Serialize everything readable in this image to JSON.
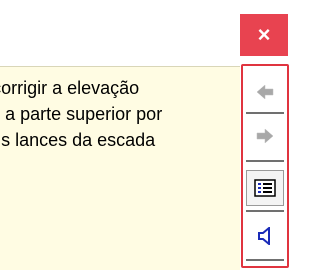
{
  "close_button": {
    "glyph": "×",
    "icon": "close-icon"
  },
  "content": {
    "lines": [
      "Se você quiser corrigir a elevação",
      "ao andar, agarre a parte superior por",
      "trás e pule alguns lances da escada"
    ]
  },
  "toolbar": {
    "buttons": [
      {
        "name": "back",
        "icon": "arrow-left-icon"
      },
      {
        "name": "forward",
        "icon": "arrow-right-icon"
      },
      {
        "name": "table-of-contents",
        "icon": "list-icon"
      },
      {
        "name": "audio",
        "icon": "speaker-icon"
      }
    ]
  },
  "colors": {
    "close_bg": "#e84350",
    "toolbar_border": "#e0343f",
    "content_bg": "#fffce3",
    "icon_gray": "#a8a8a8",
    "icon_blue": "#1a2bb8"
  }
}
